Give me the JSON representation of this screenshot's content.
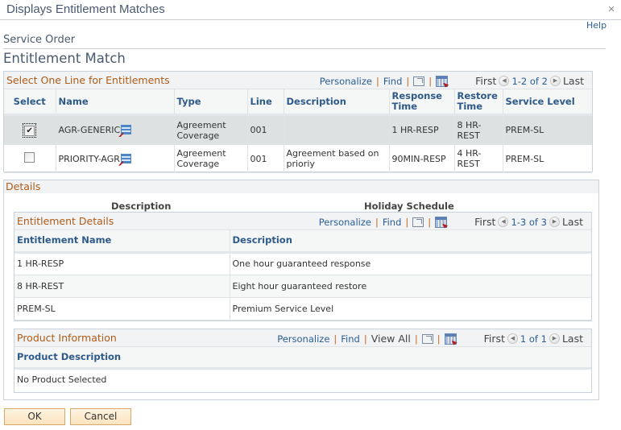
{
  "window": {
    "title": "Displays Entitlement Matches",
    "close_icon": "close-icon"
  },
  "header": {
    "help_label": "Help",
    "subtitle": "Service Order",
    "page_title": "Entitlement Match"
  },
  "entitlements_grid": {
    "title": "Select One Line for Entitlements",
    "nav": {
      "personalize": "Personalize",
      "find": "Find",
      "separator": "|",
      "first": "First",
      "range": "1-2 of 2",
      "last": "Last"
    },
    "columns": [
      "Select",
      "Name",
      "Type",
      "Line",
      "Description",
      "Response Time",
      "Restore Time",
      "Service Level"
    ],
    "rows": [
      {
        "selected": true,
        "check": "✔",
        "name": "AGR-GENERIC",
        "type": "Agreement Coverage",
        "line": "001",
        "description": "",
        "response_time": "1 HR-RESP",
        "restore_time": "8 HR-REST",
        "service_level": "PREM-SL"
      },
      {
        "selected": false,
        "check": "",
        "name": "PRIORITY-AGR",
        "type": "Agreement Coverage",
        "line": "001",
        "description": "Agreement based on prioriy",
        "response_time": "90MIN-RESP",
        "restore_time": "4 HR-REST",
        "service_level": "PREM-SL"
      }
    ]
  },
  "details": {
    "title": "Details",
    "description_label": "Description",
    "holiday_schedule_label": "Holiday Schedule",
    "entitlement_details": {
      "title": "Entitlement Details",
      "nav": {
        "personalize": "Personalize",
        "find": "Find",
        "separator": "|",
        "first": "First",
        "range": "1-3 of 3",
        "last": "Last"
      },
      "columns": [
        "Entitlement Name",
        "Description"
      ],
      "rows": [
        {
          "name": "1 HR-RESP",
          "description": "One hour guaranteed response"
        },
        {
          "name": "8 HR-REST",
          "description": "Eight hour guaranteed restore"
        },
        {
          "name": "PREM-SL",
          "description": "Premium Service Level"
        }
      ]
    },
    "product_information": {
      "title": "Product Information",
      "nav": {
        "personalize": "Personalize",
        "find": "Find",
        "view_all": "View All",
        "separator": "|",
        "first": "First",
        "range": "1 of 1",
        "last": "Last"
      },
      "columns": [
        "Product Description"
      ],
      "rows": [
        {
          "description": "No Product Selected"
        }
      ]
    }
  },
  "buttons": {
    "ok": "OK",
    "cancel": "Cancel"
  },
  "nav_icons": {
    "prev": "◀",
    "next": "▶"
  }
}
